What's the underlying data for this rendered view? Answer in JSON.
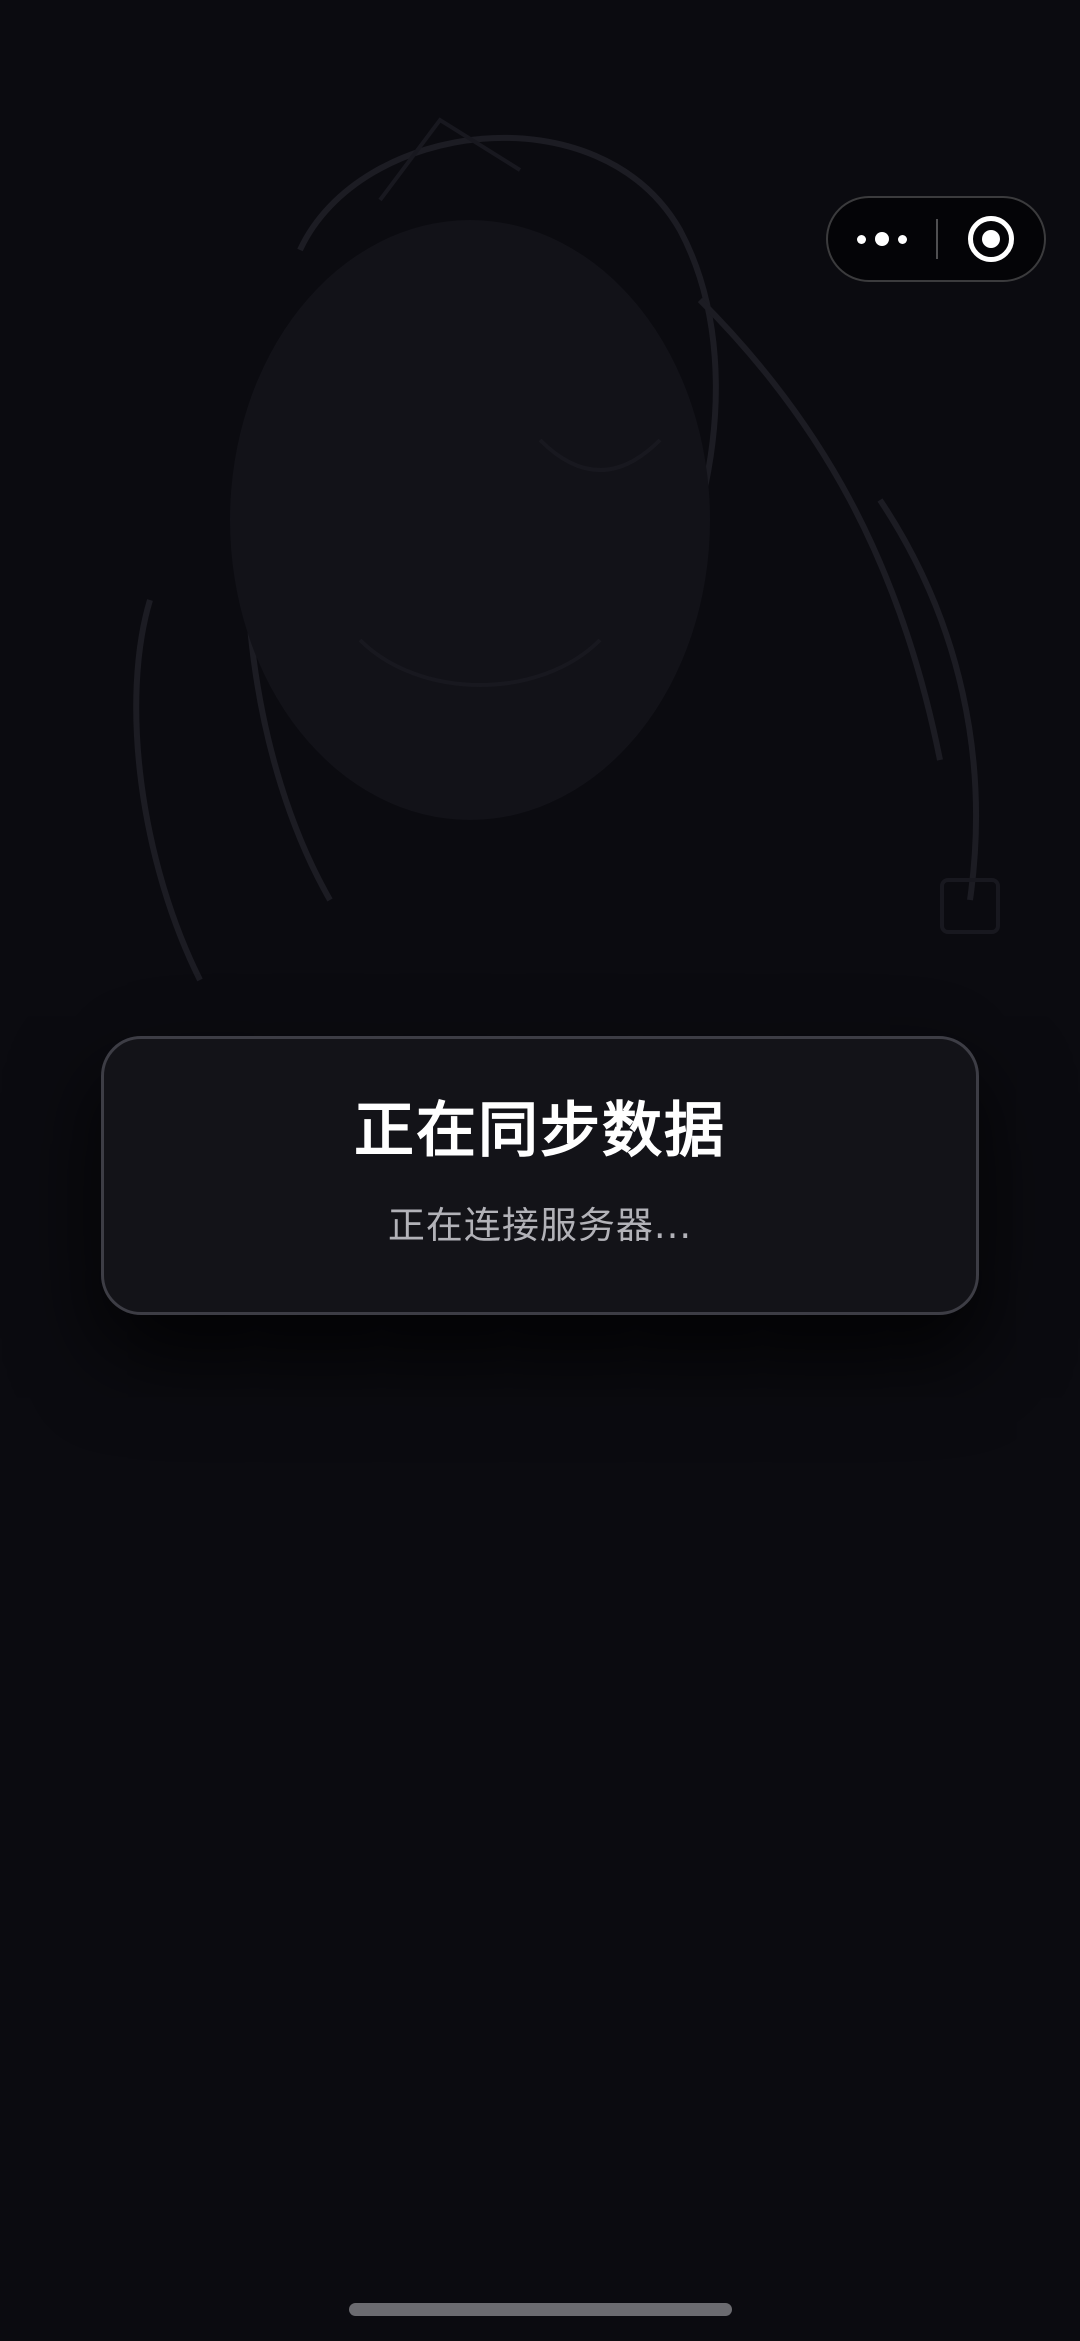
{
  "capsule": {
    "more_icon": "ellipsis-icon",
    "close_icon": "target-circle-icon"
  },
  "dialog": {
    "title": "正在同步数据",
    "message": "正在连接服务器..."
  },
  "colors": {
    "background": "#0b0b10",
    "dialog_background": "#131318",
    "dialog_border": "#3d3d45",
    "title_text": "#ffffff",
    "message_text": "#b2b2b8"
  }
}
